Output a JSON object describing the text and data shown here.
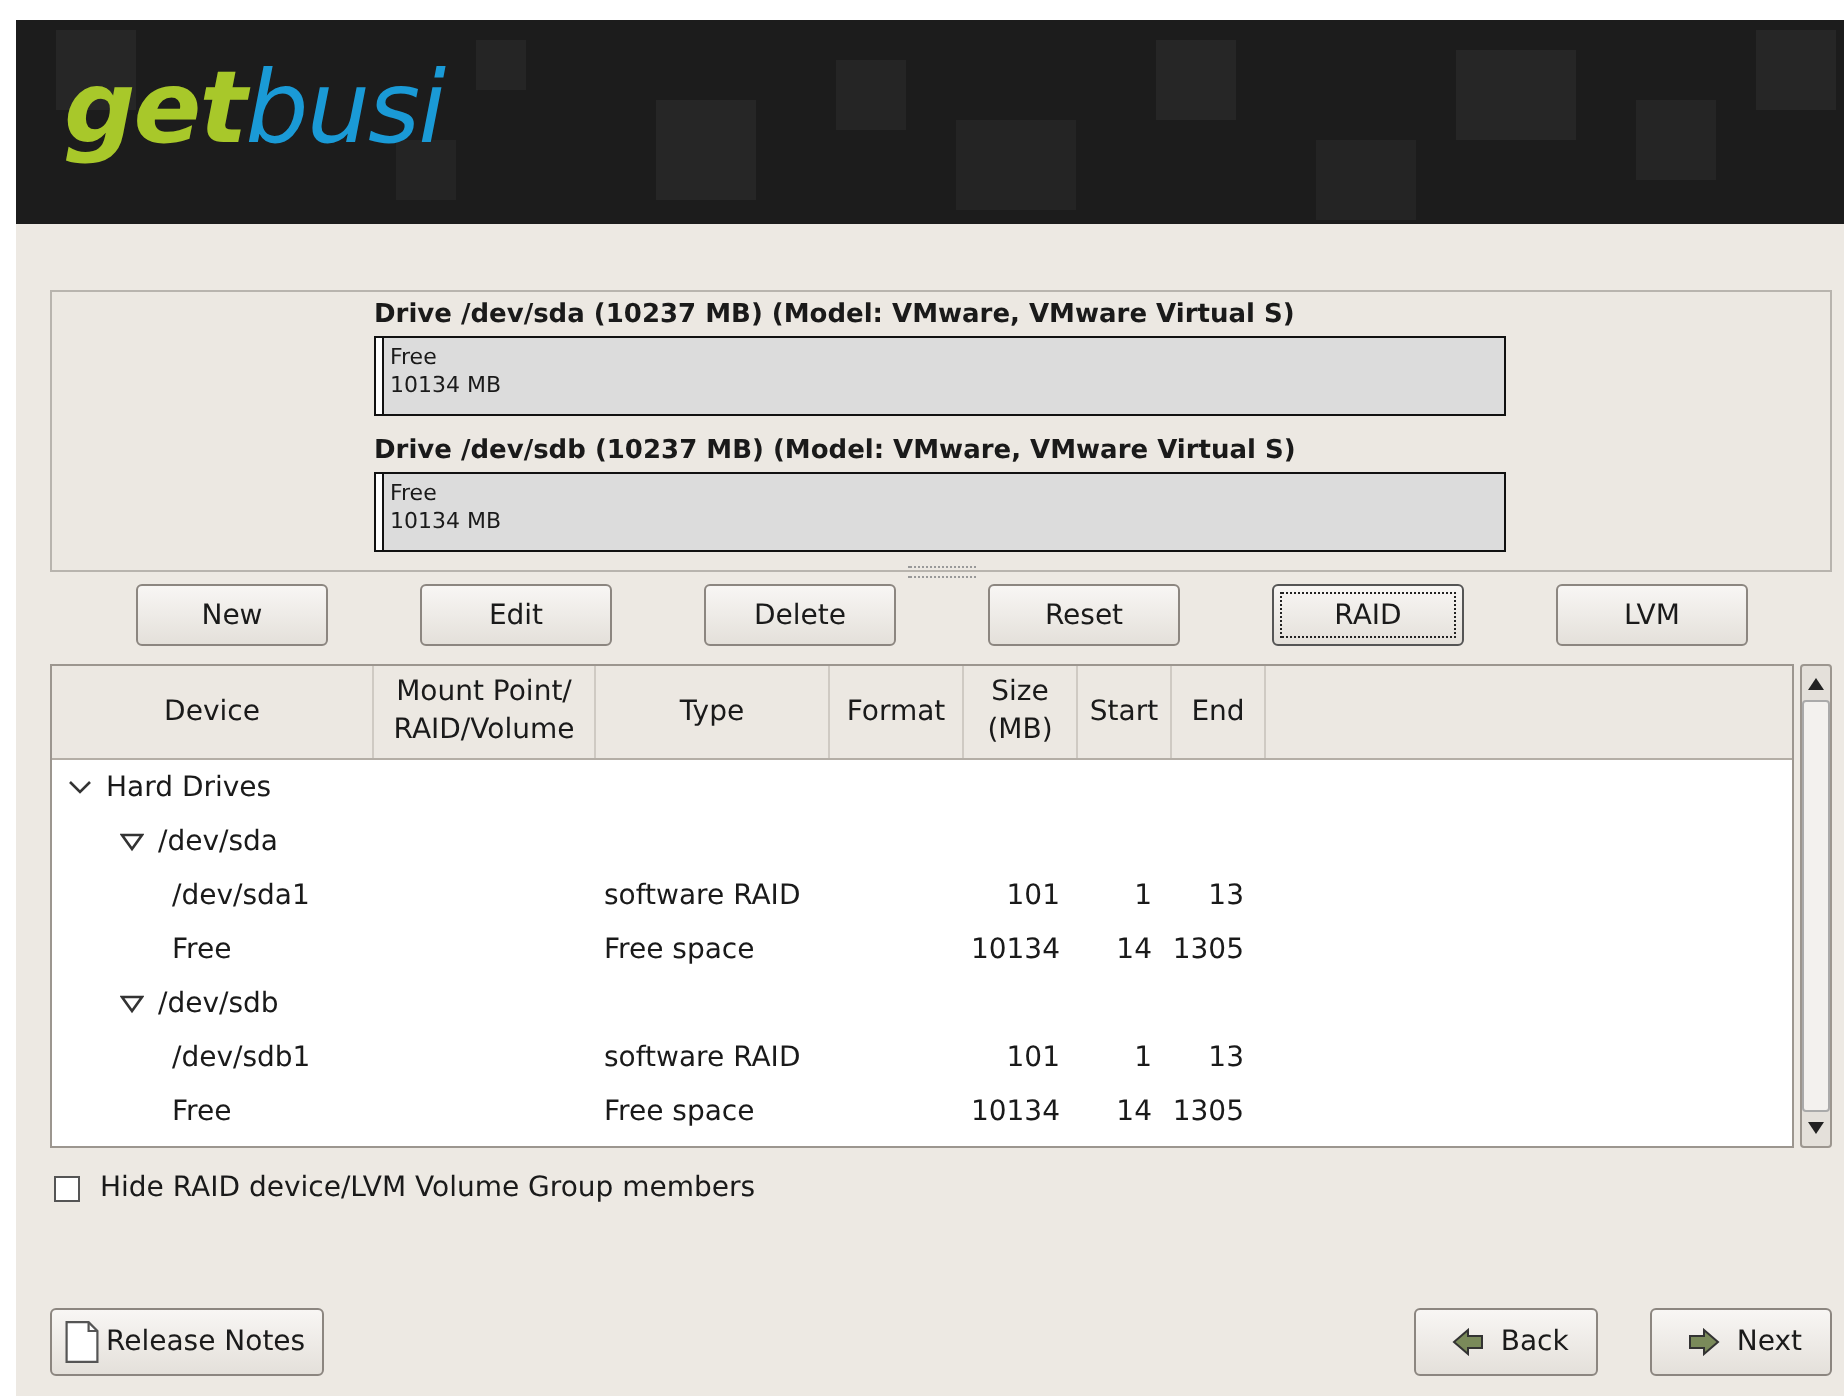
{
  "header": {
    "logo_part_1": "get",
    "logo_part_2": "busi"
  },
  "drives": [
    {
      "title": "Drive /dev/sda (10237 MB) (Model: VMware, VMware Virtual S)",
      "free_label": "Free",
      "free_size": "10134 MB"
    },
    {
      "title": "Drive /dev/sdb (10237 MB) (Model: VMware, VMware Virtual S)",
      "free_label": "Free",
      "free_size": "10134 MB"
    }
  ],
  "actions": [
    {
      "label": "New",
      "focused": false
    },
    {
      "label": "Edit",
      "focused": false
    },
    {
      "label": "Delete",
      "focused": false
    },
    {
      "label": "Reset",
      "focused": false
    },
    {
      "label": "RAID",
      "focused": true
    },
    {
      "label": "LVM",
      "focused": false
    }
  ],
  "table": {
    "columns": [
      "Device",
      "Mount Point/\nRAID/Volume",
      "Type",
      "Format",
      "Size\n(MB)",
      "Start",
      "End"
    ],
    "tree": [
      {
        "device": "Hard Drives",
        "expanded": true,
        "children": [
          {
            "device": "/dev/sda",
            "expanded": true,
            "children": [
              {
                "device": "/dev/sda1",
                "type": "software RAID",
                "size": "101",
                "start": "1",
                "end": "13"
              },
              {
                "device": "Free",
                "type": "Free space",
                "size": "10134",
                "start": "14",
                "end": "1305"
              }
            ]
          },
          {
            "device": "/dev/sdb",
            "expanded": true,
            "children": [
              {
                "device": "/dev/sdb1",
                "type": "software RAID",
                "size": "101",
                "start": "1",
                "end": "13"
              },
              {
                "device": "Free",
                "type": "Free space",
                "size": "10134",
                "start": "14",
                "end": "1305"
              }
            ]
          }
        ]
      }
    ]
  },
  "hide_members": {
    "label": "Hide RAID device/LVM Volume Group members",
    "checked": false
  },
  "footer": {
    "release_notes": "Release Notes",
    "back": "Back",
    "next": "Next"
  }
}
